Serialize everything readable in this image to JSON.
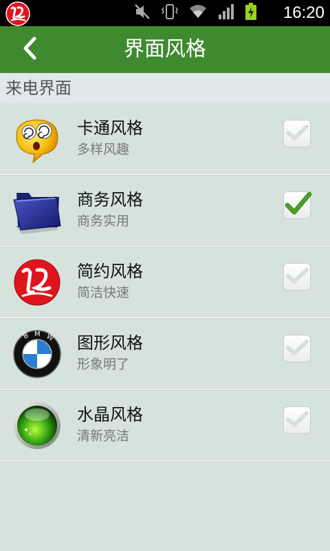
{
  "statusbar": {
    "time": "16:20",
    "icons": [
      "app-logo-icon",
      "mute-icon",
      "vibrate-icon",
      "wifi-icon",
      "signal-icon",
      "battery-charging-icon"
    ]
  },
  "header": {
    "title": "界面风格",
    "back_icon": "chevron-left-icon"
  },
  "section": {
    "title": "来电界面"
  },
  "styles": [
    {
      "name": "卡通风格",
      "desc": "多样风趣",
      "icon": "cartoon-face-icon",
      "checked": false
    },
    {
      "name": "商务风格",
      "desc": "商务实用",
      "icon": "folder-icon",
      "checked": true
    },
    {
      "name": "简约风格",
      "desc": "简洁快速",
      "icon": "app-logo-icon",
      "checked": false
    },
    {
      "name": "图形风格",
      "desc": "形象明了",
      "icon": "bmw-logo-icon",
      "checked": false
    },
    {
      "name": "水晶风格",
      "desc": "清新亮洁",
      "icon": "crystal-ball-icon",
      "checked": false
    }
  ],
  "colors": {
    "titlebar": "#3f8a2f",
    "background": "#d6e2dc",
    "check_green": "#4f9a2a"
  }
}
